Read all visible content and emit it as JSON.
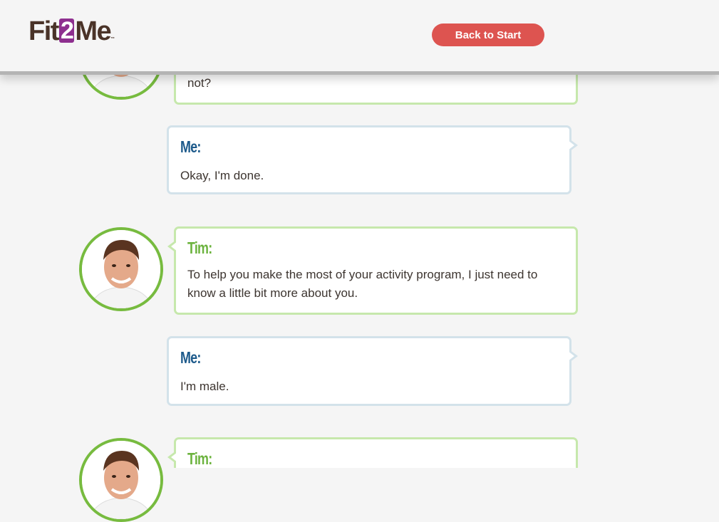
{
  "header": {
    "logo_prefix": "Fit",
    "logo_two": "2",
    "logo_suffix": "Me",
    "logo_tm": "™",
    "back_button_label": "Back to Start"
  },
  "chat": {
    "partial_tim": {
      "text": "not?"
    },
    "messages": [
      {
        "speaker": "Me:",
        "text": "Okay, I'm done."
      },
      {
        "speaker": "Tim:",
        "text": "To help you make the most of your activity program, I just need to know a little bit more about you."
      },
      {
        "speaker": "Me:",
        "text": "I'm male."
      },
      {
        "speaker": "Tim:",
        "text": ""
      }
    ]
  },
  "colors": {
    "accent_red": "#dd5450",
    "tim_green": "#6cb33e",
    "me_blue": "#1d5a8b",
    "logo_purple": "#8e2f8f",
    "logo_brown": "#4a3328"
  },
  "icons": {
    "coach_avatar": "coach-avatar-photo"
  }
}
